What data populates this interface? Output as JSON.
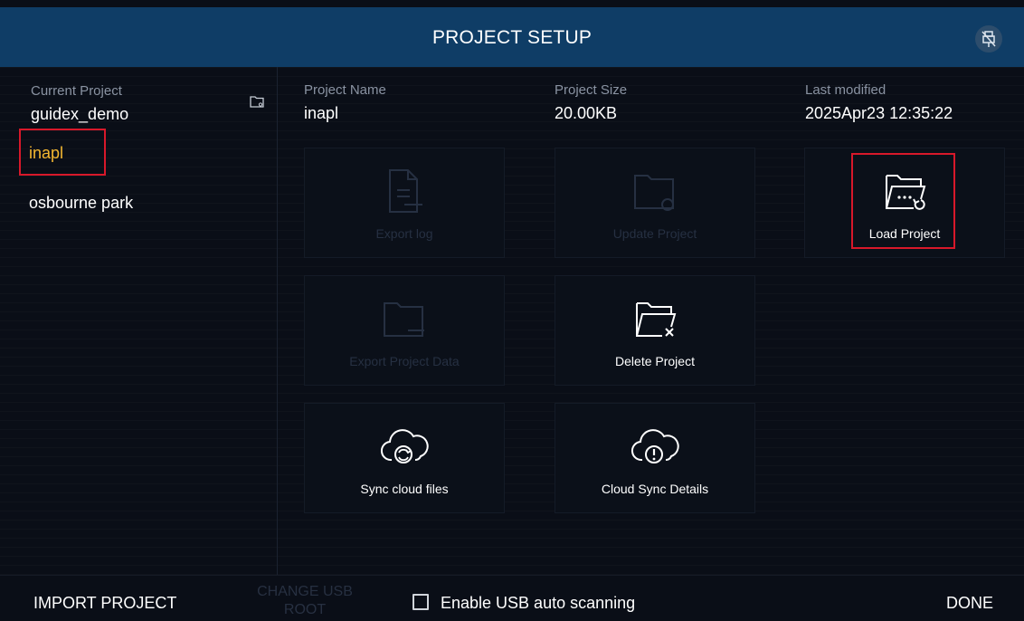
{
  "header": {
    "title": "PROJECT SETUP",
    "icon": "usb-off-icon"
  },
  "left": {
    "current_label": "Current Project",
    "current_value": "guidex_demo",
    "folder_icon": "folder-icon",
    "projects": [
      {
        "name": "inapl",
        "selected": true
      },
      {
        "name": "osbourne park",
        "selected": false
      }
    ]
  },
  "info": {
    "name_label": "Project Name",
    "name_value": "inapl",
    "size_label": "Project Size",
    "size_value": "20.00KB",
    "modified_label": "Last modified",
    "modified_value": "2025Apr23 12:35:22"
  },
  "actions": {
    "export_log": {
      "label": "Export log",
      "enabled": false,
      "icon": "document-export-icon"
    },
    "update_project": {
      "label": "Update Project",
      "enabled": false,
      "icon": "folder-update-icon"
    },
    "load_project": {
      "label": "Load Project",
      "enabled": true,
      "icon": "folder-load-icon"
    },
    "export_project_data": {
      "label": "Export Project Data",
      "enabled": false,
      "icon": "folder-export-icon"
    },
    "delete_project": {
      "label": "Delete Project",
      "enabled": true,
      "icon": "folder-delete-icon"
    },
    "sync_cloud_files": {
      "label": "Sync cloud files",
      "enabled": true,
      "icon": "cloud-sync-icon"
    },
    "cloud_sync_details": {
      "label": "Cloud Sync Details",
      "enabled": true,
      "icon": "cloud-alert-icon"
    }
  },
  "footer": {
    "import_label": "IMPORT PROJECT",
    "usb_root_line1": "CHANGE USB",
    "usb_root_line2": "ROOT",
    "usb_scan_label": "Enable USB auto scanning",
    "usb_scan_checked": false,
    "done_label": "DONE"
  },
  "colors": {
    "header_bg": "#0f3d66",
    "background": "#0a0e17",
    "selected_text": "#f5b731",
    "highlight_border": "#d8182a"
  }
}
